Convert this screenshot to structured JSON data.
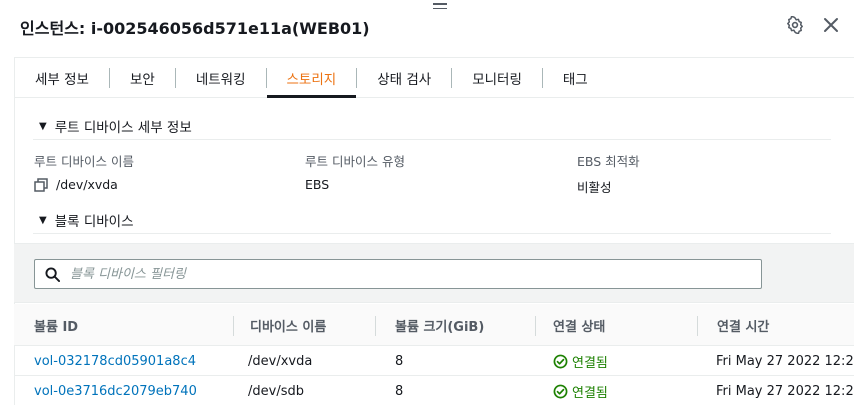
{
  "header": {
    "title": "인스턴스: i-002546056d571e11a(WEB01)"
  },
  "tabs": [
    {
      "label": "세부 정보",
      "active": false
    },
    {
      "label": "보안",
      "active": false
    },
    {
      "label": "네트워킹",
      "active": false
    },
    {
      "label": "스토리지",
      "active": true
    },
    {
      "label": "상태 검사",
      "active": false
    },
    {
      "label": "모니터링",
      "active": false
    },
    {
      "label": "태그",
      "active": false
    }
  ],
  "root_device": {
    "heading": "루트 디바이스 세부 정보",
    "name_label": "루트 디바이스 이름",
    "name_value": "/dev/xvda",
    "type_label": "루트 디바이스 유형",
    "type_value": "EBS",
    "ebs_label": "EBS 최적화",
    "ebs_value": "비활성"
  },
  "block_devices": {
    "heading": "블록 디바이스",
    "filter_placeholder": "블록 디바이스 필터링",
    "columns": [
      "볼륨 ID",
      "디바이스 이름",
      "볼륨 크기(GiB)",
      "연결 상태",
      "연결 시간"
    ],
    "rows": [
      {
        "volume_id": "vol-032178cd05901a8c4",
        "device": "/dev/xvda",
        "size": "8",
        "status": "연결됨",
        "time": "Fri May 27 2022 12:2"
      },
      {
        "volume_id": "vol-0e3716dc2079eb740",
        "device": "/dev/sdb",
        "size": "8",
        "status": "연결됨",
        "time": "Fri May 27 2022 12:2"
      }
    ]
  },
  "colors": {
    "accent": "#ec7211",
    "link": "#0073bb",
    "success": "#1d8102"
  },
  "icons": {
    "settings": "gear-icon",
    "close": "close-icon",
    "copy": "copy-icon",
    "search": "search-icon",
    "status": "check-circle-icon"
  }
}
